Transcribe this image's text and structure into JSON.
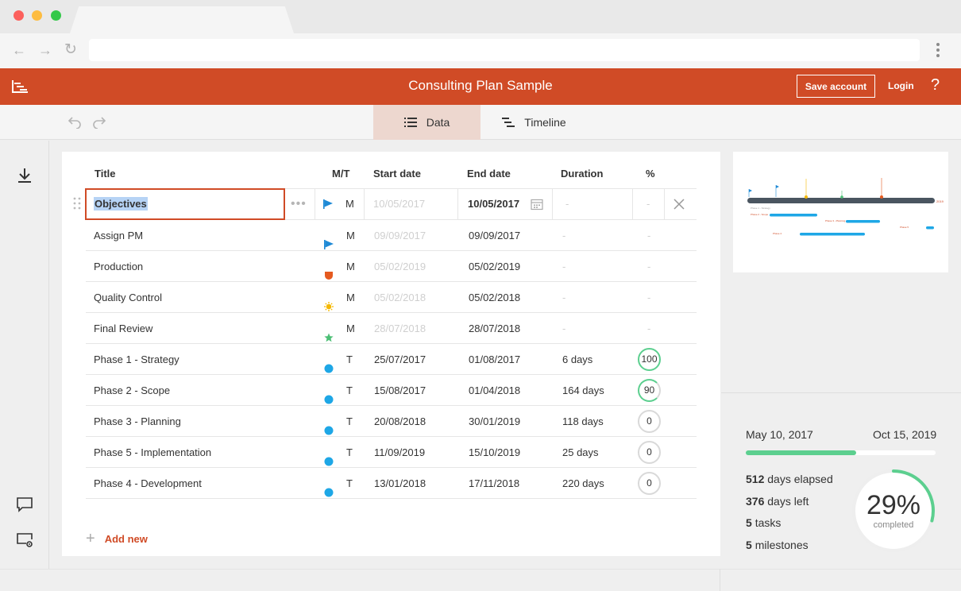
{
  "browser": {
    "back_icon": "arrow-left-icon",
    "forward_icon": "arrow-right-icon",
    "reload_icon": "reload-icon",
    "url": "",
    "menu_icon": "kebab-menu-icon"
  },
  "header": {
    "title": "Consulting Plan Sample",
    "save_account_label": "Save account",
    "login_label": "Login",
    "help_label": "?",
    "brand_color": "#d04b26"
  },
  "toolbar": {
    "tabs": [
      {
        "label": "Data",
        "icon": "list-icon",
        "active": true
      },
      {
        "label": "Timeline",
        "icon": "timeline-icon",
        "active": false
      }
    ]
  },
  "table": {
    "columns": [
      "Title",
      "M/T",
      "Start date",
      "End date",
      "Duration",
      "%"
    ],
    "editing_row": {
      "title": "Objectives",
      "type": "M",
      "icon": "flag",
      "start_date": "10/05/2017",
      "end_date": "10/05/2017",
      "duration": "-",
      "percent": "-"
    },
    "rows": [
      {
        "title": "Assign PM",
        "icon": "flag",
        "icon_color": "#1f8ad6",
        "type": "M",
        "start_date": "09/09/2017",
        "end_date": "09/09/2017",
        "duration": "-",
        "percent": "-"
      },
      {
        "title": "Production",
        "icon": "shield",
        "icon_color": "#e55a1f",
        "type": "M",
        "start_date": "05/02/2019",
        "end_date": "05/02/2019",
        "duration": "-",
        "percent": "-"
      },
      {
        "title": "Quality Control",
        "icon": "sun",
        "icon_color": "#f5b800",
        "type": "M",
        "start_date": "05/02/2018",
        "end_date": "05/02/2018",
        "duration": "-",
        "percent": "-"
      },
      {
        "title": "Final Review",
        "icon": "star",
        "icon_color": "#4cbf75",
        "type": "M",
        "start_date": "28/07/2018",
        "end_date": "28/07/2018",
        "duration": "-",
        "percent": "-"
      },
      {
        "title": "Phase 1 - Strategy",
        "icon": "dot",
        "icon_color": "#1ea7e6",
        "type": "T",
        "start_date": "25/07/2017",
        "end_date": "01/08/2017",
        "duration": "6 days",
        "percent": "100"
      },
      {
        "title": "Phase 2 - Scope",
        "icon": "dot",
        "icon_color": "#1ea7e6",
        "type": "T",
        "start_date": "15/08/2017",
        "end_date": "01/04/2018",
        "duration": "164 days",
        "percent": "90"
      },
      {
        "title": "Phase 3 - Planning",
        "icon": "dot",
        "icon_color": "#1ea7e6",
        "type": "T",
        "start_date": "20/08/2018",
        "end_date": "30/01/2019",
        "duration": "118 days",
        "percent": "0"
      },
      {
        "title": "Phase 5 - Implementation",
        "icon": "dot",
        "icon_color": "#1ea7e6",
        "type": "T",
        "start_date": "11/09/2019",
        "end_date": "15/10/2019",
        "duration": "25 days",
        "percent": "0"
      },
      {
        "title": "Phase 4 - Development",
        "icon": "dot",
        "icon_color": "#1ea7e6",
        "type": "T",
        "start_date": "13/01/2018",
        "end_date": "17/11/2018",
        "duration": "220 days",
        "percent": "0"
      }
    ],
    "add_new_label": "Add new"
  },
  "stats": {
    "start_date": "May 10, 2017",
    "end_date": "Oct 15, 2019",
    "progress_fraction": 0.58,
    "days_elapsed": "512",
    "days_elapsed_label": "days elapsed",
    "days_left": "376",
    "days_left_label": "days left",
    "tasks": "5",
    "tasks_label": "tasks",
    "milestones": "5",
    "milestones_label": "milestones",
    "completed_percent": "29%",
    "completed_label": "completed",
    "completed_fraction": 0.29
  }
}
